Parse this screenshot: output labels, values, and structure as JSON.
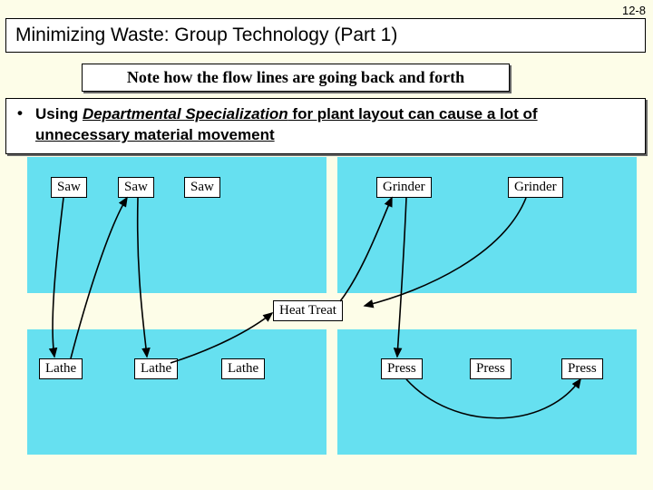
{
  "page_number": "12-8",
  "title": "Minimizing Waste: Group Technology (Part 1)",
  "note": "Note how the flow lines are going back and forth",
  "bullet_lead": "Using ",
  "bullet_emph": "Departmental Specialization",
  "bullet_tail": " for plant layout can cause a lot of unnecessary material movement",
  "machines": {
    "saw": "Saw",
    "grinder": "Grinder",
    "heat_treat": "Heat Treat",
    "lathe": "Lathe",
    "press": "Press"
  }
}
